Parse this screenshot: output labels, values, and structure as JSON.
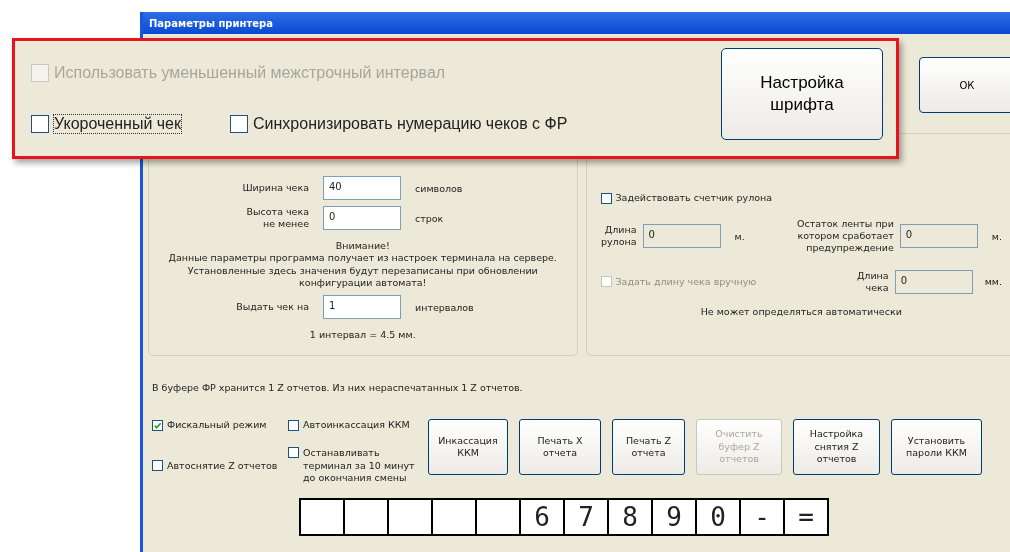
{
  "window": {
    "title": "Параметры принтера"
  },
  "callout": {
    "options": [
      {
        "label": "Использовать уменьшенный межстрочный интервал",
        "checked": false,
        "disabled": true,
        "focused": false
      },
      {
        "label": "Укороченный чек",
        "checked": false,
        "disabled": false,
        "focused": true
      },
      {
        "label": "Синхронизировать нумерацию чеков с ФР",
        "checked": false,
        "disabled": false,
        "focused": false
      }
    ],
    "font_button": "Настройка шрифта"
  },
  "ok_button": "ОК",
  "receipt_panel": {
    "fields": [
      {
        "label": "Ширина чека",
        "value": "40",
        "unit": "символов"
      },
      {
        "label": "Высота чека не менее",
        "value": "0",
        "unit": "строк"
      }
    ],
    "notice_title": "Внимание!",
    "notice": "Данные параметры программа получает из настроек терминала на сервере. Установленные здесь значения будут перезаписаны при обновлении конфигурации автомата!",
    "issue_field": {
      "label": "Выдать чек на",
      "value": "1",
      "unit": "интервалов"
    },
    "interval_note": "1 интервал = 4.5 мм."
  },
  "roll_panel": {
    "counter_option": {
      "label": "Задействовать счетчик рулона",
      "checked": false,
      "disabled": false
    },
    "roll_length": {
      "label": "Длина рулона",
      "value": "0",
      "unit": "м."
    },
    "warning_rest": {
      "label": "Остаток ленты при котором сработает предупреждение",
      "value": "0",
      "unit": "м."
    },
    "manual_option": {
      "label": "Задать длину чека вручную",
      "checked": false,
      "disabled": true
    },
    "receipt_length": {
      "label": "Длина чека",
      "value": "0",
      "unit": "мм."
    },
    "auto_note": "Не может определяться автоматически"
  },
  "buffer_info": "В буфере ФР хранится 1 Z отчетов. Из них нераспечатанных 1 Z отчетов.",
  "options": [
    {
      "label": "Фискальный режим",
      "checked": true,
      "disabled": false
    },
    {
      "label": "Автоснятие Z отчетов",
      "checked": false,
      "disabled": false
    },
    {
      "label": "Автоинкассация ККМ",
      "checked": false,
      "disabled": false
    },
    {
      "label": "Останавливать терминал за 10 минут до окончания смены",
      "checked": false,
      "disabled": false
    }
  ],
  "buttons": [
    {
      "label": "Инкассация ККМ",
      "disabled": false
    },
    {
      "label": "Печать X отчета",
      "disabled": false
    },
    {
      "label": "Печать Z отчета",
      "disabled": false
    },
    {
      "label": "Очистить буфер Z отчетов",
      "disabled": true
    },
    {
      "label": "Настройка снятия Z отчетов",
      "disabled": false
    },
    {
      "label": "Установить пароли ККМ",
      "disabled": false
    }
  ],
  "keyboard": [
    {
      "kind": "cut"
    },
    {
      "kind": "cut"
    },
    {
      "kind": "cut"
    },
    {
      "kind": "cut"
    },
    {
      "kind": "cut"
    },
    {
      "kind": "key",
      "label": "6"
    },
    {
      "kind": "key",
      "label": "7"
    },
    {
      "kind": "key",
      "label": "8"
    },
    {
      "kind": "key",
      "label": "9"
    },
    {
      "kind": "key",
      "label": "0"
    },
    {
      "kind": "key",
      "label": "-"
    },
    {
      "kind": "key",
      "label": "="
    }
  ]
}
